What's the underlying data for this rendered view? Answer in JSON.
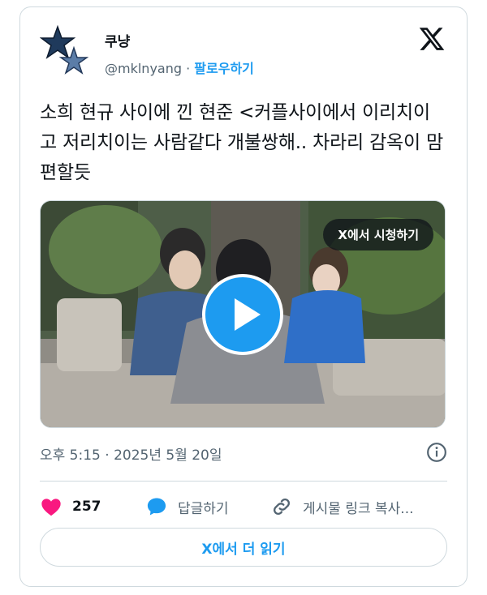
{
  "author": {
    "display_name": "쿠냥",
    "handle": "@mklnyang",
    "separator": "·",
    "follow_label": "팔로우하기",
    "avatar_icon": "star-avatar-icon"
  },
  "tweet": {
    "text": "소희 현규 사이에 낀 현준  <커플사이에서 이리치이고 저리치이는 사람같다 개불쌍해.. 차라리 감옥이 맘편할듯"
  },
  "media": {
    "watch_label": "X에서 시청하기",
    "play_icon": "play-icon"
  },
  "meta": {
    "timestamp": "오후 5:15 · 2025년 5월 20일",
    "info_icon": "info-icon"
  },
  "actions": {
    "likes_count": "257",
    "reply_label": "답글하기",
    "copy_link_label": "게시물 링크 복사..."
  },
  "footer": {
    "read_more_label": "X에서 더 읽기"
  },
  "colors": {
    "accent": "#1d9bf0",
    "like": "#f91880",
    "text": "#0f1419",
    "muted": "#536471",
    "border": "#cfd9de"
  }
}
